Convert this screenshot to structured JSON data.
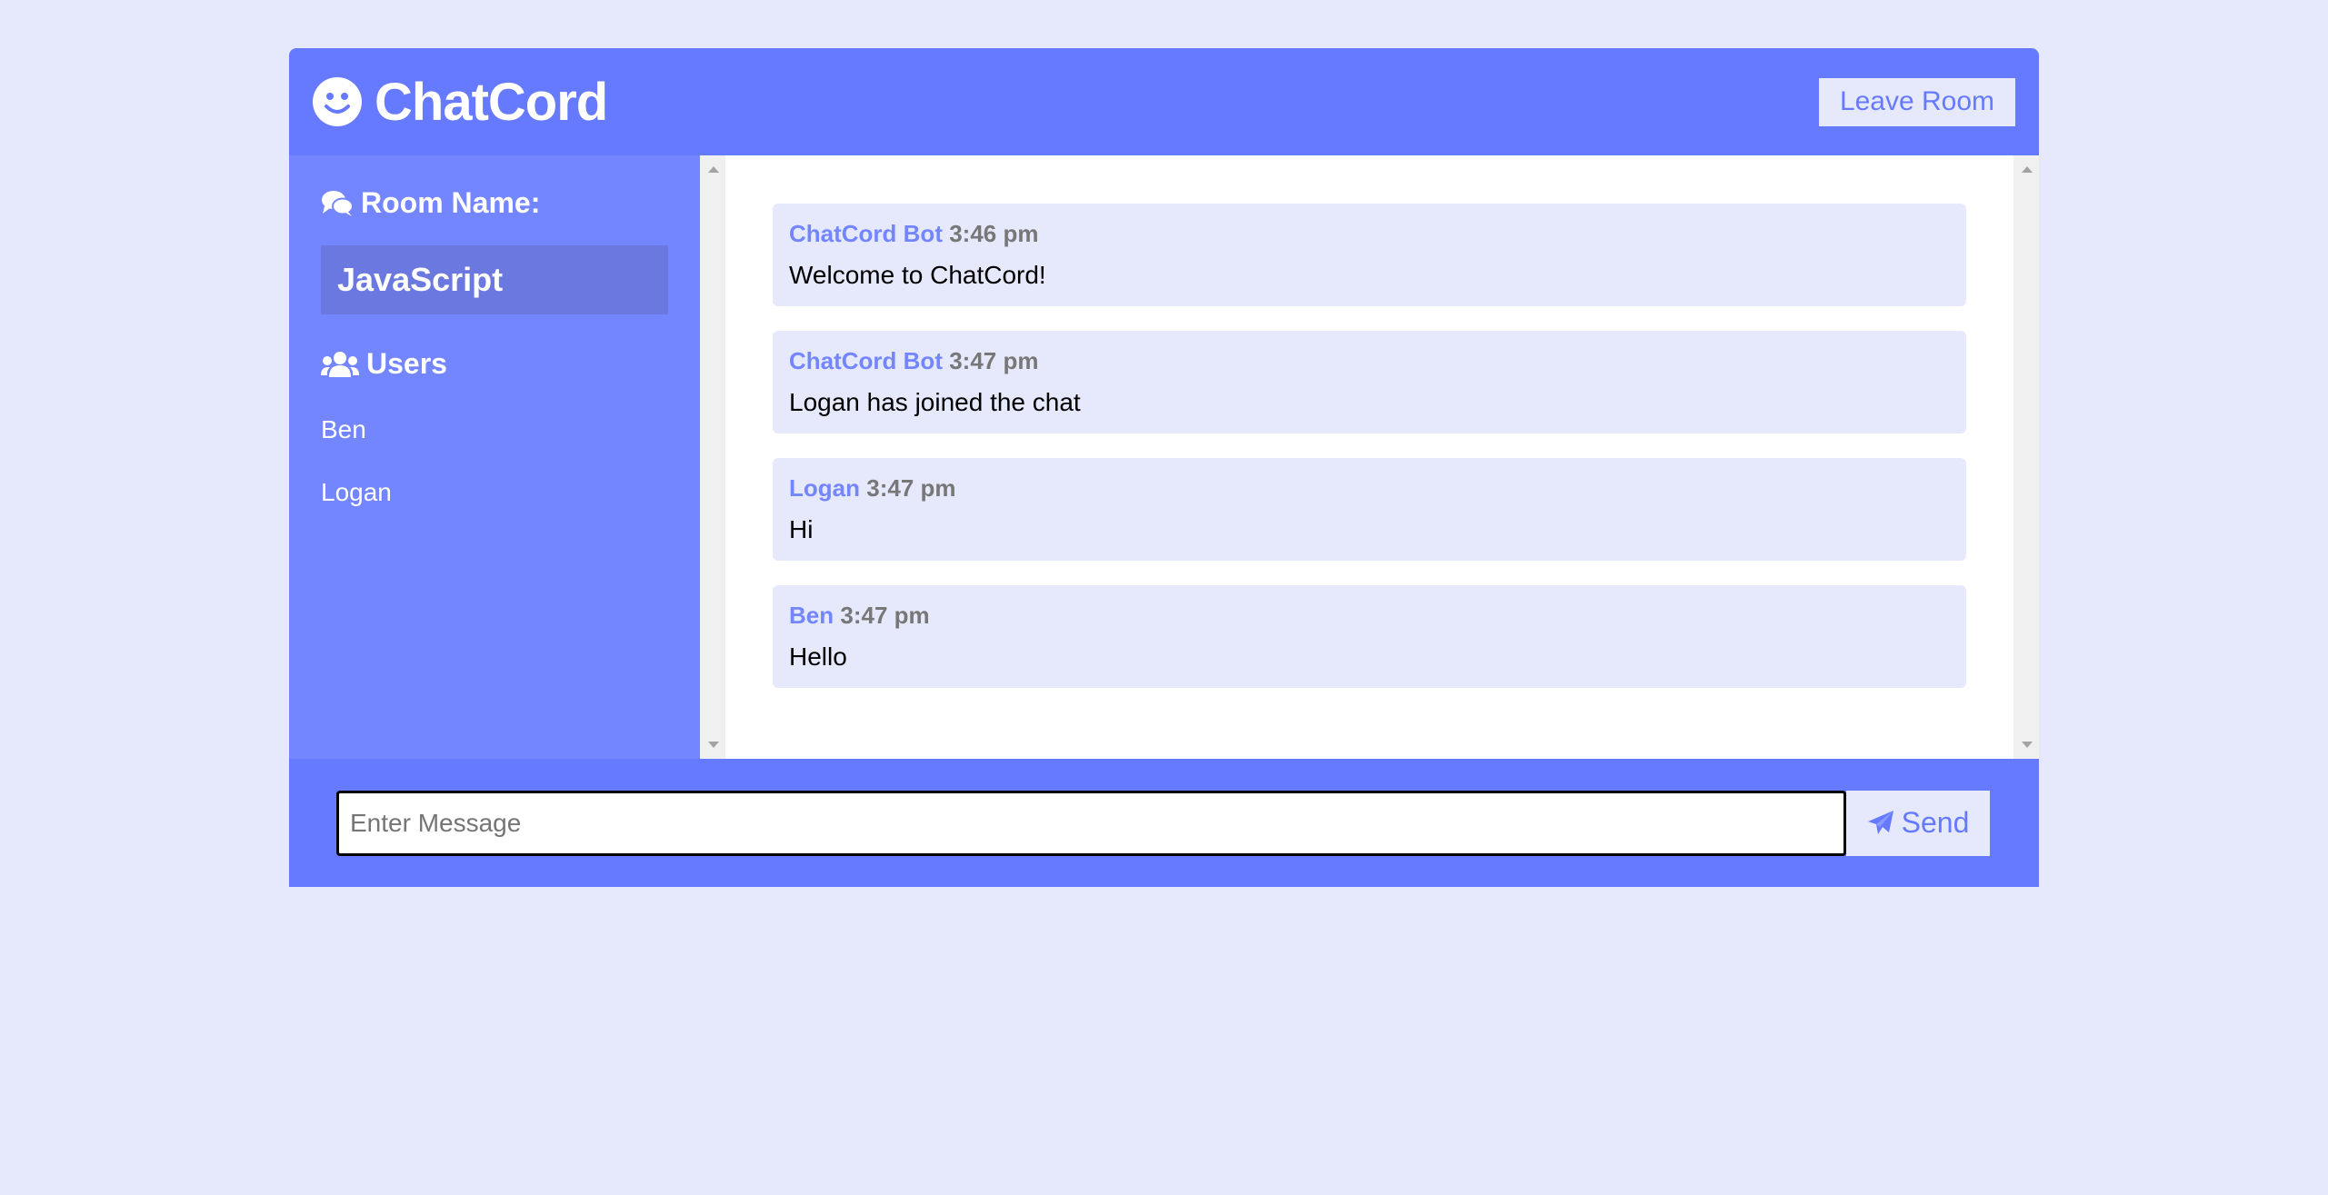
{
  "header": {
    "title": "ChatCord",
    "leave_label": "Leave Room"
  },
  "sidebar": {
    "room_heading": "Room Name:",
    "room_name": "JavaScript",
    "users_heading": "Users",
    "users": [
      "Ben",
      "Logan"
    ]
  },
  "messages": [
    {
      "author": "ChatCord Bot",
      "time": "3:46 pm",
      "text": "Welcome to ChatCord!"
    },
    {
      "author": "ChatCord Bot",
      "time": "3:47 pm",
      "text": "Logan has joined the chat"
    },
    {
      "author": "Logan",
      "time": "3:47 pm",
      "text": "Hi"
    },
    {
      "author": "Ben",
      "time": "3:47 pm",
      "text": "Hello"
    }
  ],
  "form": {
    "placeholder": "Enter Message",
    "value": "",
    "send_label": "Send"
  },
  "colors": {
    "primary": "#667aff",
    "secondary": "#7386ff",
    "light": "#e6e9fc",
    "room_bg": "#6a78e0"
  },
  "icons": {
    "brand": "smile-icon",
    "room": "comments-icon",
    "users": "users-icon",
    "send": "paper-plane-icon"
  }
}
